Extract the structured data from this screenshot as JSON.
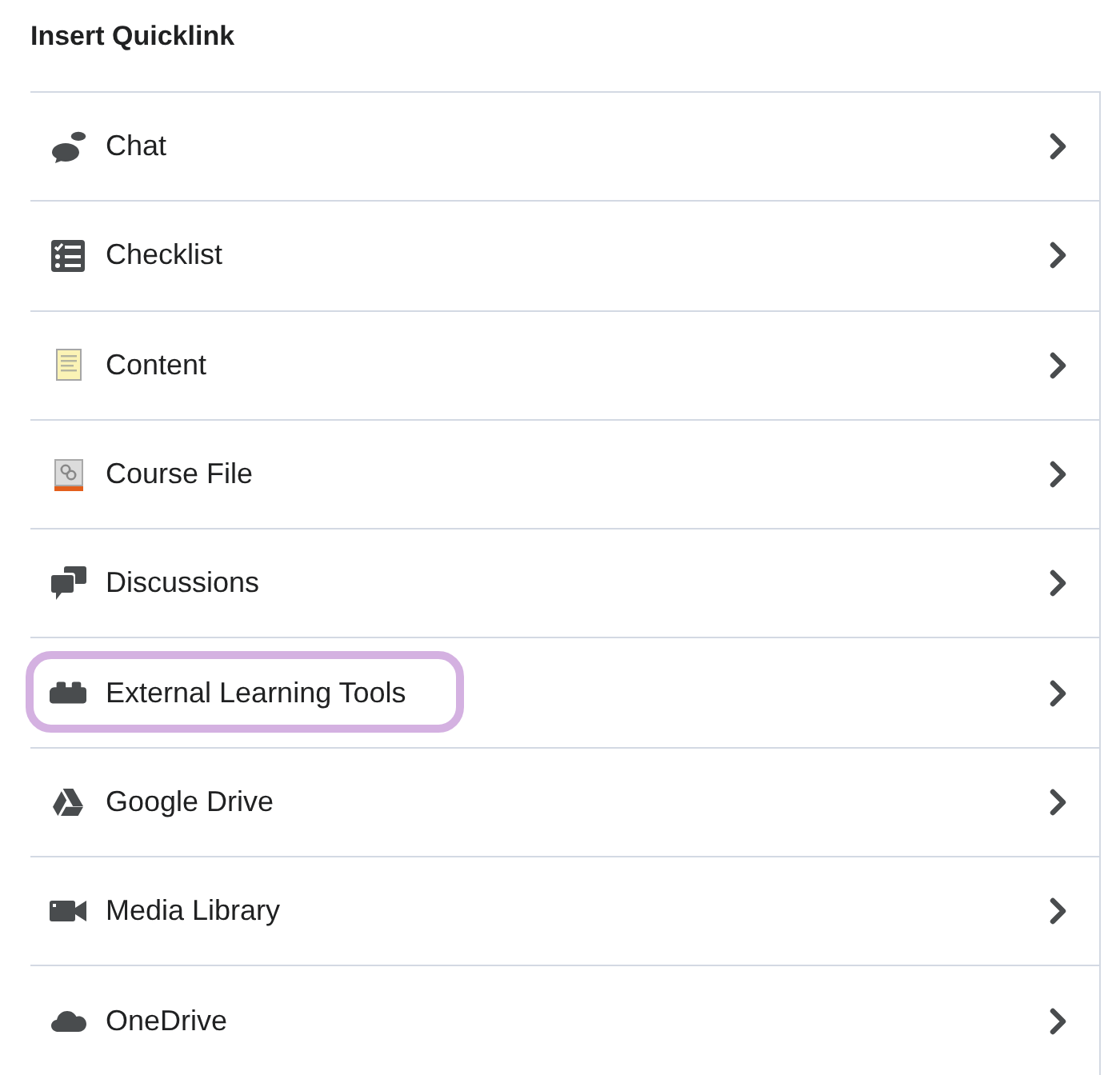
{
  "panel": {
    "title": "Insert Quicklink"
  },
  "items": [
    {
      "label": "Chat",
      "highlighted": false
    },
    {
      "label": "Checklist",
      "highlighted": false
    },
    {
      "label": "Content",
      "highlighted": false
    },
    {
      "label": "Course File",
      "highlighted": false
    },
    {
      "label": "Discussions",
      "highlighted": false
    },
    {
      "label": "External Learning Tools",
      "highlighted": true
    },
    {
      "label": "Google Drive",
      "highlighted": false
    },
    {
      "label": "Media Library",
      "highlighted": false
    },
    {
      "label": "OneDrive",
      "highlighted": false
    }
  ]
}
